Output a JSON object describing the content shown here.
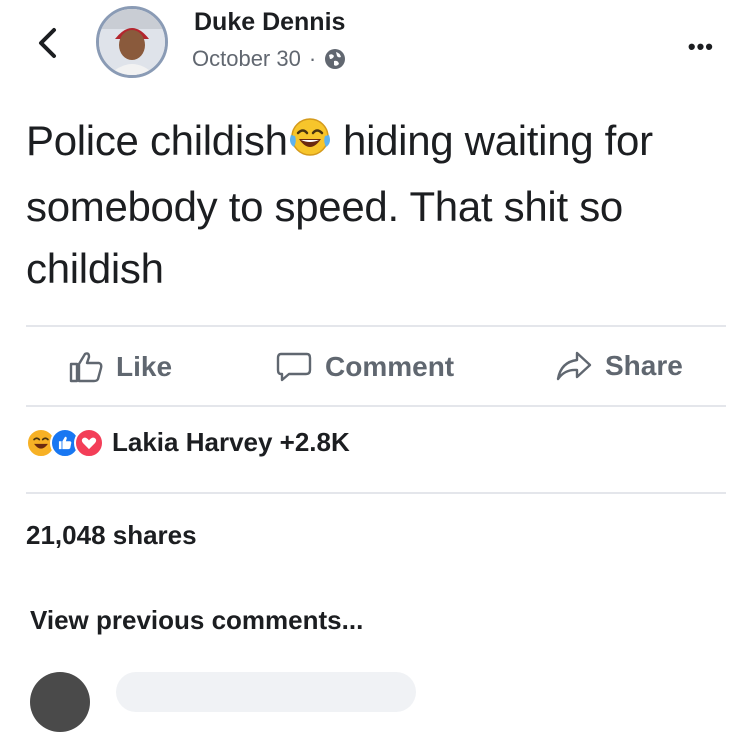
{
  "header": {
    "author": "Duke Dennis",
    "date": "October 30",
    "separator": "·",
    "privacy_icon": "globe-icon",
    "back_icon": "chevron-left-icon",
    "more_label": "•••"
  },
  "post": {
    "text_before": "Police childish",
    "emoji": "face-with-tears-of-joy",
    "text_after": " hiding waiting for somebody to speed. That shit so childish"
  },
  "actions": {
    "like": "Like",
    "comment": "Comment",
    "share": "Share"
  },
  "reactions": {
    "icons": [
      "haha-reaction-icon",
      "like-reaction-icon",
      "love-reaction-icon"
    ],
    "summary": "Lakia Harvey +2.8K"
  },
  "shares": "21,048 shares",
  "comments": {
    "view_previous": "View previous comments..."
  },
  "colors": {
    "text": "#1c1e21",
    "muted": "#606770",
    "like_blue": "#1877f2",
    "love_red": "#f33e58",
    "haha_yellow": "#f7b125",
    "divider": "#e4e6eb"
  }
}
